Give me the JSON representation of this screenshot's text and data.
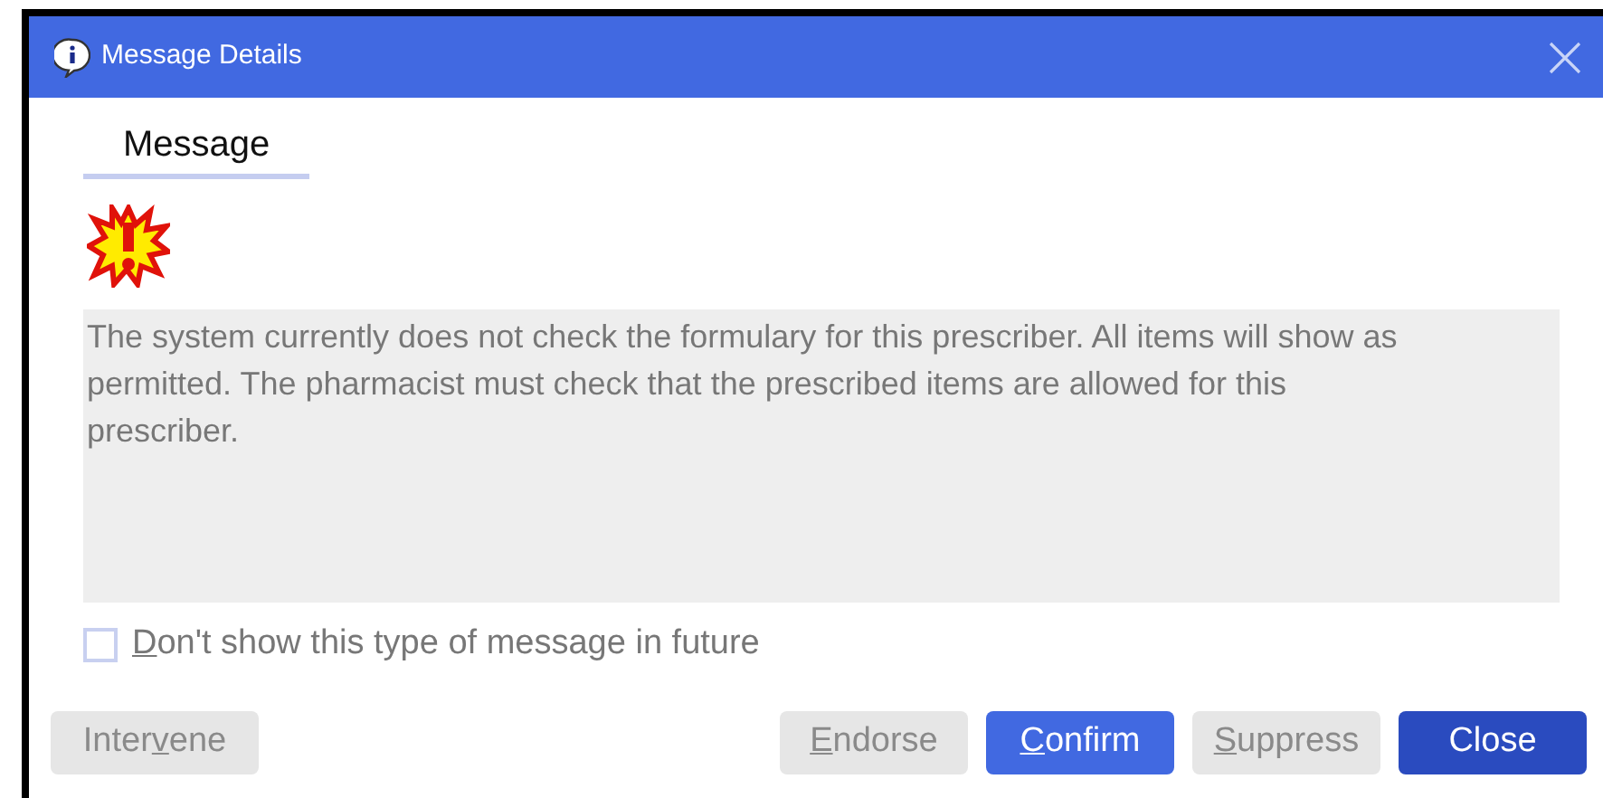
{
  "window": {
    "title": "Message Details"
  },
  "tabs": [
    {
      "label": "Message",
      "selected": true
    }
  ],
  "message": {
    "text": "The system currently does not check the formulary for this prescriber. All items will show as permitted. The pharmacist must check that the prescribed items are allowed for this prescriber."
  },
  "suppress_option": {
    "label": {
      "key": "D",
      "after": "on't show this type of message in future"
    },
    "checked": false
  },
  "left_buttons": [
    {
      "label": {
        "before": "Inter",
        "key": "v",
        "after": "ene"
      },
      "kind": "plain",
      "disabled": true
    }
  ],
  "right_buttons": [
    {
      "label": {
        "key": "E",
        "after": "ndorse"
      },
      "kind": "plain",
      "disabled": true
    },
    {
      "label": {
        "key": "C",
        "after": "onfirm"
      },
      "kind": "primary",
      "disabled": false
    },
    {
      "label": {
        "key": "S",
        "after": "uppress"
      },
      "kind": "plain",
      "disabled": true
    },
    {
      "label": {
        "before": "Close"
      },
      "kind": "dark",
      "disabled": false
    }
  ]
}
